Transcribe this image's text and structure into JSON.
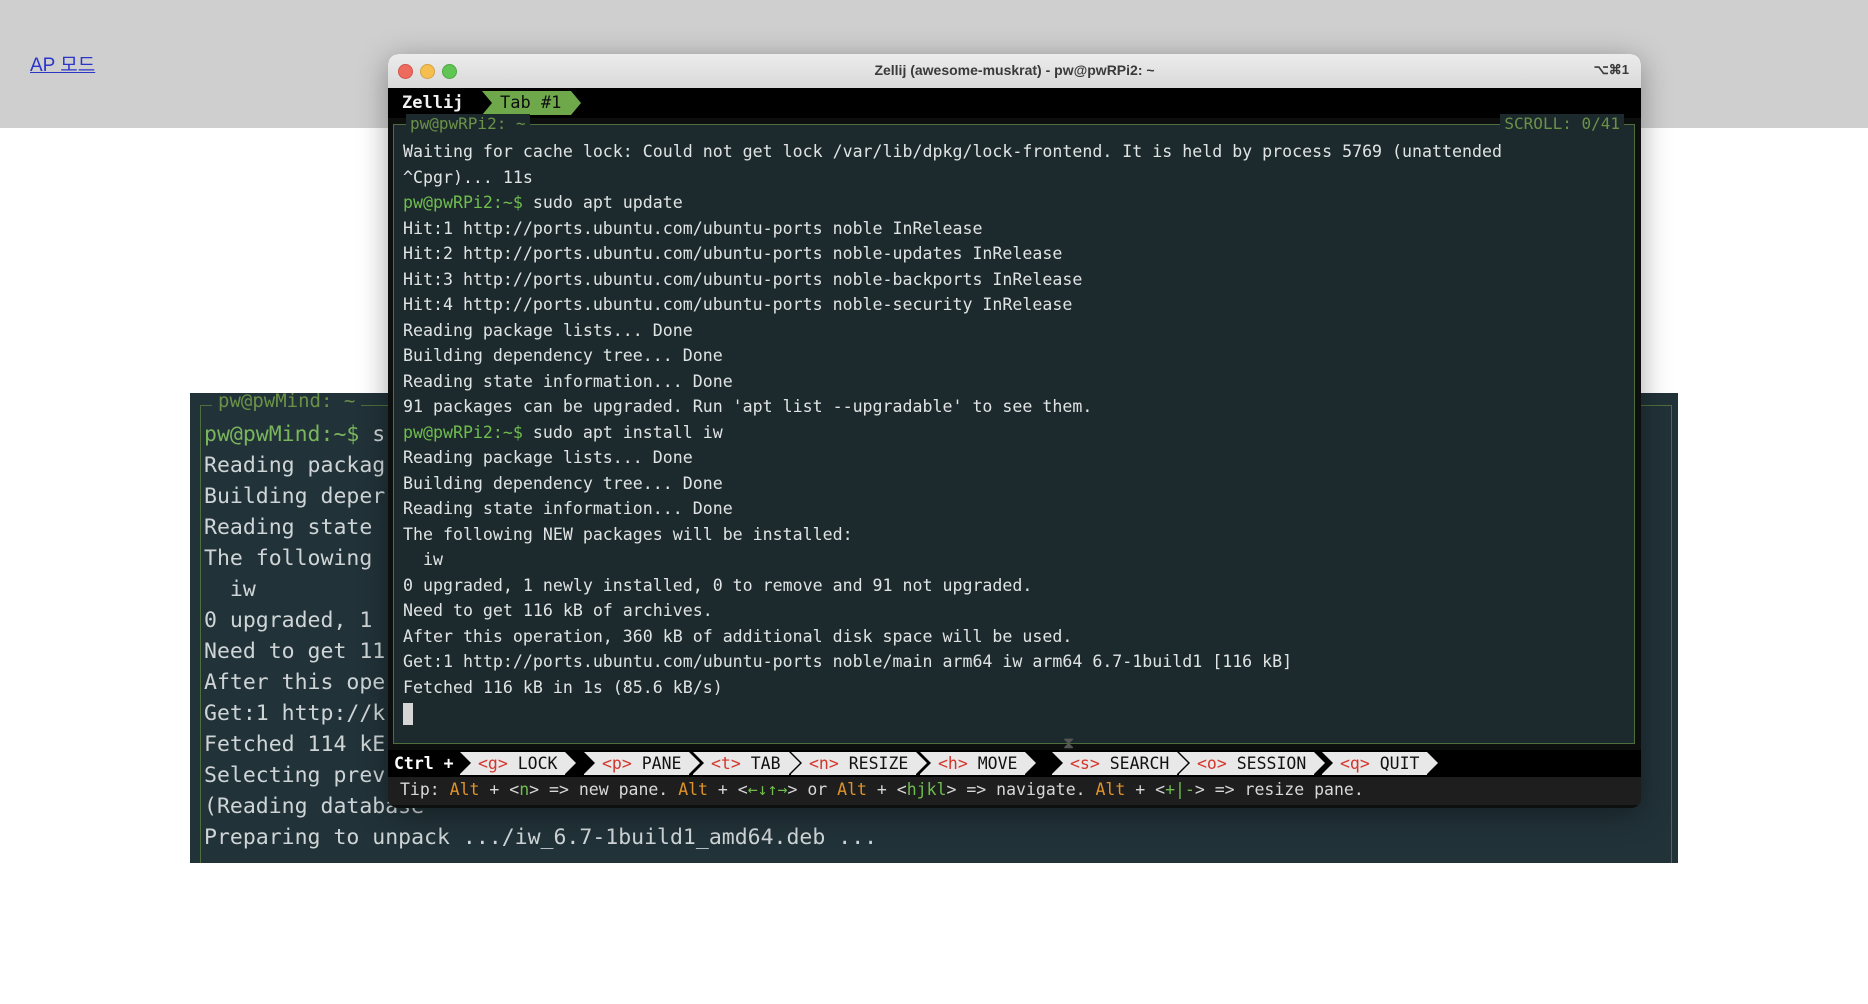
{
  "page": {
    "link": "AP 모드"
  },
  "background_terminal": {
    "title": "pw@pwMind: ~",
    "lines": [
      {
        "prompt": "pw@pwMind:~$",
        "text": " s"
      },
      {
        "prompt": "",
        "text": "Reading packag"
      },
      {
        "prompt": "",
        "text": "Building deper"
      },
      {
        "prompt": "",
        "text": "Reading state"
      },
      {
        "prompt": "",
        "text": "The following"
      },
      {
        "prompt": "",
        "text": "  iw"
      },
      {
        "prompt": "",
        "text": "0 upgraded, 1"
      },
      {
        "prompt": "",
        "text": "Need to get 11"
      },
      {
        "prompt": "",
        "text": "After this ope"
      },
      {
        "prompt": "",
        "text": "Get:1 http://k"
      },
      {
        "prompt": "",
        "text": "Fetched 114 kE"
      },
      {
        "prompt": "",
        "text": "Selecting prev"
      },
      {
        "prompt": "",
        "text": "(Reading database"
      },
      {
        "prompt": "",
        "text": "Preparing to unpack .../iw_6.7-1build1_amd64.deb ..."
      }
    ]
  },
  "window": {
    "title": "Zellij (awesome-muskrat) - pw@pwRPi2: ~",
    "shortcut": "⌥⌘1"
  },
  "tabbar": {
    "app": "Zellij",
    "tab": "Tab #1"
  },
  "pane": {
    "title": "pw@pwRPi2: ~",
    "scroll": "SCROLL:  0/41",
    "lines": [
      {
        "prompt": "",
        "text": "Waiting for cache lock: Could not get lock /var/lib/dpkg/lock-frontend. It is held by process 5769 (unattended"
      },
      {
        "prompt": "",
        "text": "^Cpgr)... 11s"
      },
      {
        "prompt": "pw@pwRPi2:~$",
        "text": " sudo apt update"
      },
      {
        "prompt": "",
        "text": "Hit:1 http://ports.ubuntu.com/ubuntu-ports noble InRelease"
      },
      {
        "prompt": "",
        "text": "Hit:2 http://ports.ubuntu.com/ubuntu-ports noble-updates InRelease"
      },
      {
        "prompt": "",
        "text": "Hit:3 http://ports.ubuntu.com/ubuntu-ports noble-backports InRelease"
      },
      {
        "prompt": "",
        "text": "Hit:4 http://ports.ubuntu.com/ubuntu-ports noble-security InRelease"
      },
      {
        "prompt": "",
        "text": "Reading package lists... Done"
      },
      {
        "prompt": "",
        "text": "Building dependency tree... Done"
      },
      {
        "prompt": "",
        "text": "Reading state information... Done"
      },
      {
        "prompt": "",
        "text": "91 packages can be upgraded. Run 'apt list --upgradable' to see them."
      },
      {
        "prompt": "pw@pwRPi2:~$",
        "text": " sudo apt install iw"
      },
      {
        "prompt": "",
        "text": "Reading package lists... Done"
      },
      {
        "prompt": "",
        "text": "Building dependency tree... Done"
      },
      {
        "prompt": "",
        "text": "Reading state information... Done"
      },
      {
        "prompt": "",
        "text": "The following NEW packages will be installed:"
      },
      {
        "prompt": "",
        "text": "  iw"
      },
      {
        "prompt": "",
        "text": "0 upgraded, 1 newly installed, 0 to remove and 91 not upgraded."
      },
      {
        "prompt": "",
        "text": "Need to get 116 kB of archives."
      },
      {
        "prompt": "",
        "text": "After this operation, 360 kB of additional disk space will be used."
      },
      {
        "prompt": "",
        "text": "Get:1 http://ports.ubuntu.com/ubuntu-ports noble/main arm64 iw arm64 6.7-1build1 [116 kB]"
      },
      {
        "prompt": "",
        "text": "Fetched 116 kB in 1s (85.6 kB/s)"
      }
    ]
  },
  "statusbar": {
    "ctrl": "Ctrl +",
    "items": [
      {
        "key": "<g>",
        "label": " LOCK"
      },
      {
        "key": "<p>",
        "label": " PANE"
      },
      {
        "key": "<t>",
        "label": " TAB"
      },
      {
        "key": "<n>",
        "label": " RESIZE"
      },
      {
        "key": "<h>",
        "label": " MOVE"
      },
      {
        "key": "<s>",
        "label": " SEARCH"
      },
      {
        "key": "<o>",
        "label": " SESSION"
      },
      {
        "key": "<q>",
        "label": " QUIT"
      }
    ]
  },
  "tip": {
    "t1": "Tip: ",
    "alt": "Alt",
    "t2": " + <",
    "k1": "n",
    "t3": "> => new pane. ",
    "t4": " + <",
    "k2": "←↓↑→",
    "t5": "> or ",
    "t6": " + <",
    "k3": "hjkl",
    "t7": "> => navigate. ",
    "t8": " + <",
    "k4": "+|-",
    "t9": "> => resize pane."
  },
  "colors": {
    "prompt_green": "#6fbd4f",
    "tab_green": "#6fa84a",
    "key_red": "#d4352b",
    "alt_orange": "#e0922a",
    "terminal_bg": "#1d2a2d"
  }
}
